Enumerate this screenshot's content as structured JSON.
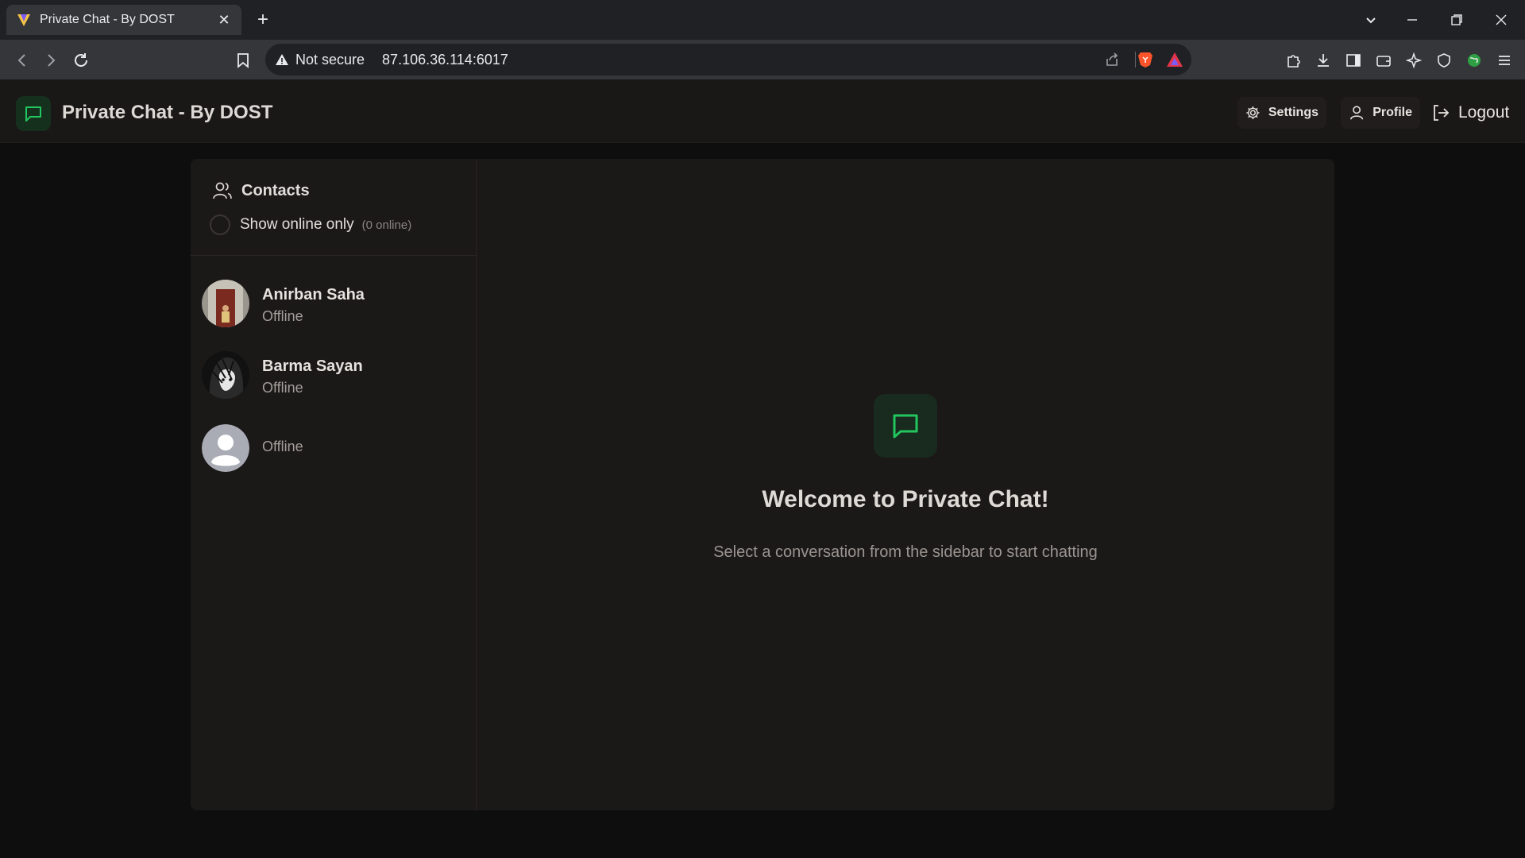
{
  "browser": {
    "tab_title": "Private Chat - By DOST",
    "new_tab_symbol": "+",
    "close_symbol": "✕",
    "security_label": "Not secure",
    "url": "87.106.36.114:6017"
  },
  "header": {
    "title": "Private Chat - By DOST",
    "settings_label": "Settings",
    "profile_label": "Profile",
    "logout_label": "Logout"
  },
  "sidebar": {
    "title": "Contacts",
    "online_filter_label": "Show online only",
    "online_count": "(0 online)",
    "contacts": [
      {
        "name": "Anirban Saha",
        "status": "Offline"
      },
      {
        "name": "Barma Sayan",
        "status": "Offline"
      },
      {
        "name": "",
        "status": "Offline"
      }
    ]
  },
  "main": {
    "welcome_title": "Welcome to Private Chat!",
    "welcome_subtitle": "Select a conversation from the sidebar to start chatting"
  },
  "colors": {
    "accent": "#22c55e",
    "background": "#0f0e0e",
    "panel": "#1b1818"
  },
  "icons": {
    "logo": "chat-bubble-icon",
    "settings": "gear-icon",
    "profile": "user-icon",
    "logout": "logout-icon",
    "contacts": "users-icon"
  }
}
